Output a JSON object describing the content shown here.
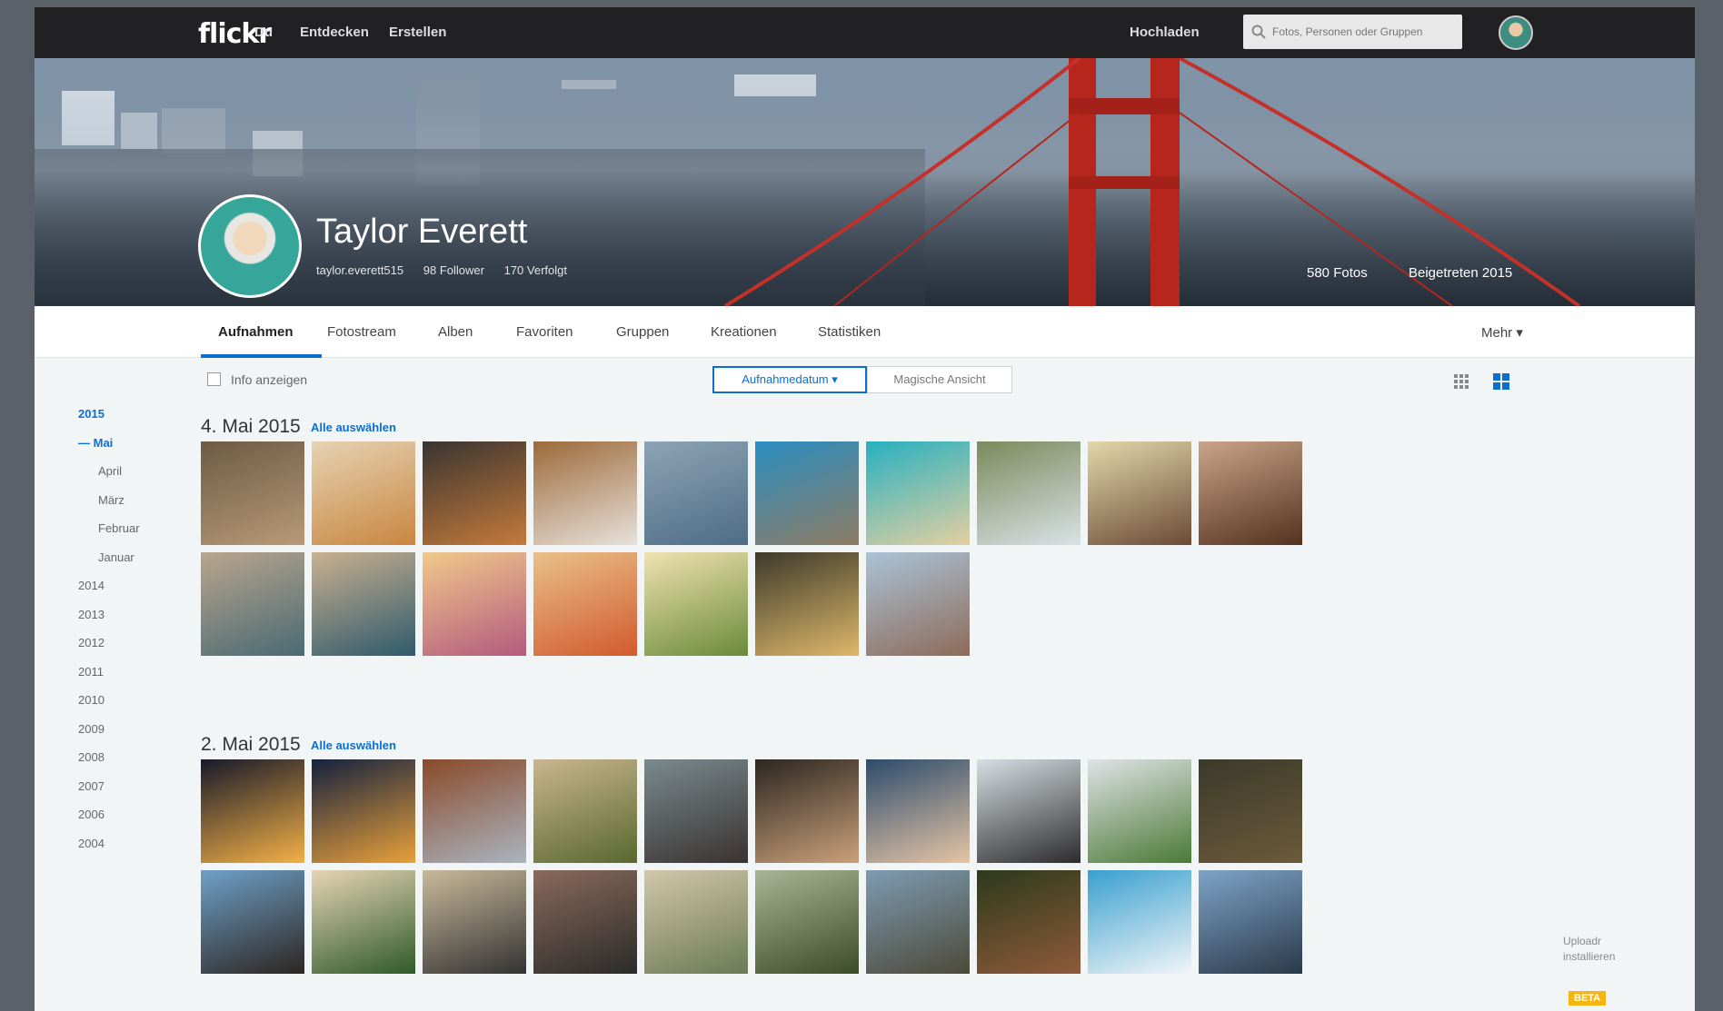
{
  "topbar": {
    "logo": "flickr",
    "nav": [
      "Du",
      "Entdecken",
      "Erstellen"
    ],
    "upload": "Hochladen",
    "search_placeholder": "Fotos, Personen oder Gruppen"
  },
  "profile": {
    "name": "Taylor Everett",
    "username": "taylor.everett515",
    "followers": "98 Follower",
    "following": "170 Verfolgt",
    "photo_count": "580 Fotos",
    "joined": "Beigetreten 2015"
  },
  "tabs": [
    "Aufnahmen",
    "Fotostream",
    "Alben",
    "Favoriten",
    "Gruppen",
    "Kreationen",
    "Statistiken"
  ],
  "more_label": "Mehr ▾",
  "toolbar": {
    "info_label": "Info anzeigen",
    "sort_date": "Aufnahmedatum ▾",
    "sort_magic": "Magische Ansicht"
  },
  "years": [
    {
      "label": "2015",
      "active": true
    },
    {
      "label": "— Mai",
      "active": true
    },
    {
      "label": "April",
      "active": false
    },
    {
      "label": "März",
      "active": false
    },
    {
      "label": "Februar",
      "active": false
    },
    {
      "label": "Januar",
      "active": false
    },
    {
      "label": "2014",
      "active": false
    },
    {
      "label": "2013",
      "active": false
    },
    {
      "label": "2012",
      "active": false
    },
    {
      "label": "2011",
      "active": false
    },
    {
      "label": "2010",
      "active": false
    },
    {
      "label": "2009",
      "active": false
    },
    {
      "label": "2008",
      "active": false
    },
    {
      "label": "2007",
      "active": false
    },
    {
      "label": "2006",
      "active": false
    },
    {
      "label": "2004",
      "active": false
    }
  ],
  "sections": [
    {
      "date": "4. Mai 2015",
      "select_all": "Alle auswählen",
      "photos": [
        [
          "#6e5a45",
          "#b79a77"
        ],
        [
          "#e6d2b3",
          "#c8863f"
        ],
        [
          "#3a3531",
          "#c47a3b"
        ],
        [
          "#9c6a3a",
          "#e7e1da"
        ],
        [
          "#8da3b6",
          "#4e6d84"
        ],
        [
          "#2b8fc2",
          "#8d7a63"
        ],
        [
          "#27b0c0",
          "#e3cfa0"
        ],
        [
          "#7a8a5b",
          "#d9e2e6"
        ],
        [
          "#e3d7a9",
          "#6b4b37"
        ],
        [
          "#caa48a",
          "#53321f"
        ],
        [
          "#b9a58d",
          "#4a6a73"
        ],
        [
          "#c9b08f",
          "#2f5a6c"
        ],
        [
          "#f0c98a",
          "#b35a7e"
        ],
        [
          "#e8c08a",
          "#d25a2d"
        ],
        [
          "#f0e2b0",
          "#6a8a3a"
        ],
        [
          "#3d3a2b",
          "#ddb76a"
        ],
        [
          "#a9c3d7",
          "#8e6b5a"
        ]
      ]
    },
    {
      "date": "2. Mai 2015",
      "select_all": "Alle auswählen",
      "photos": [
        [
          "#181a2a",
          "#f3b046"
        ],
        [
          "#15213f",
          "#e8a03a"
        ],
        [
          "#8a4a2a",
          "#a9b4bf"
        ],
        [
          "#c9b58e",
          "#59682f"
        ],
        [
          "#7a8a8e",
          "#3a3331"
        ],
        [
          "#2c2620",
          "#c9a07a"
        ],
        [
          "#2c4c6d",
          "#e5c4a4"
        ],
        [
          "#d7dee3",
          "#2c2c2c"
        ],
        [
          "#dfe3e6",
          "#4b7a36"
        ],
        [
          "#3b3a2a",
          "#6c5a3a"
        ],
        [
          "#6ea0c7",
          "#2d2622"
        ],
        [
          "#e6d4b6",
          "#2f5a2a"
        ],
        [
          "#c9b99a",
          "#333"
        ],
        [
          "#8a6a5a",
          "#2b2b2b"
        ],
        [
          "#d1c6a9",
          "#6b7a56"
        ],
        [
          "#a8b594",
          "#3d4c28"
        ],
        [
          "#7d9bb2",
          "#4d4a3a"
        ],
        [
          "#2c3a1c",
          "#8f5a3a"
        ],
        [
          "#3a9fcf",
          "#f1f5f7"
        ],
        [
          "#7ea3c7",
          "#2b3a4a"
        ]
      ]
    }
  ],
  "uploadr": {
    "line1": "Uploadr",
    "line2": "installieren",
    "beta": "BETA"
  }
}
